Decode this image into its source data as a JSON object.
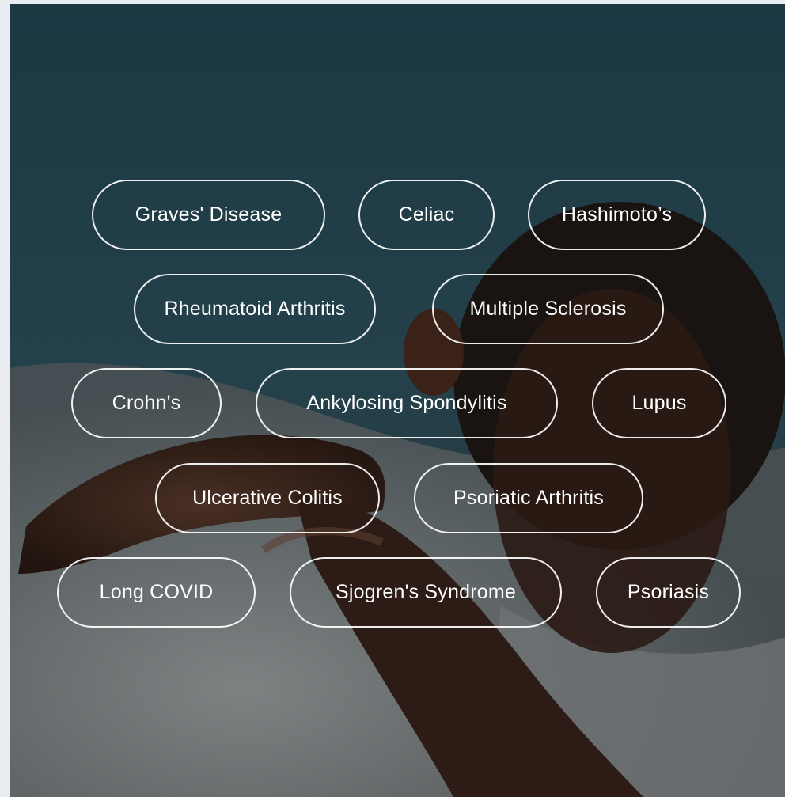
{
  "conditions": [
    "Graves' Disease",
    "Celiac",
    "Hashimoto’s",
    "Rheumatoid Arthritis",
    "Multiple Sclerosis",
    "Crohn's",
    "Ankylosing Spondylitis",
    "Lupus",
    "Ulcerative Colitis",
    "Psoriatic Arthritis",
    "Long COVID",
    "Sjogren's Syndrome",
    "Psoriasis"
  ],
  "colors": {
    "background_top": "#1d3b46",
    "background_bottom": "#2a2d2f",
    "pill_border": "#ffffff",
    "text": "#ffffff"
  }
}
